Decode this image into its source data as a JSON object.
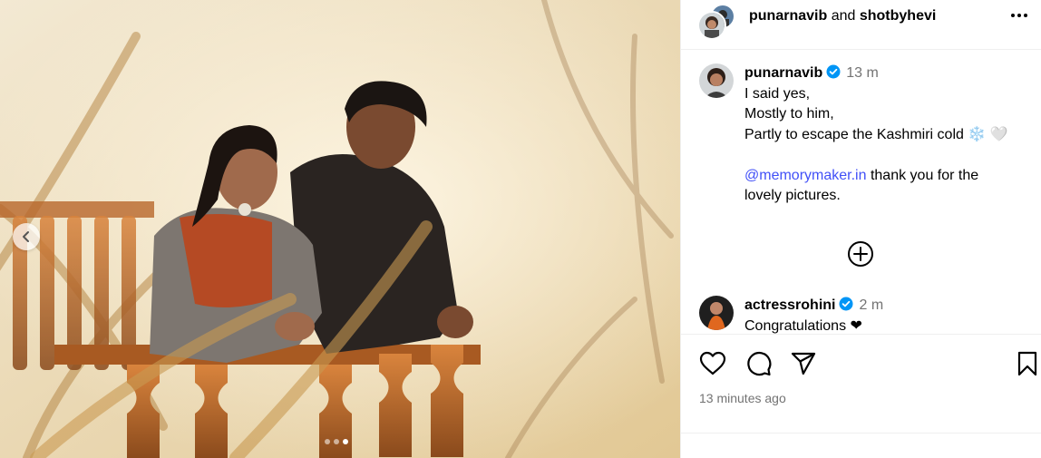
{
  "post": {
    "carousel": {
      "slide_count": 3,
      "active_index": 2
    },
    "header": {
      "user1": "punarnavib",
      "connector": "and",
      "user2": "shotbyhevi"
    },
    "caption": {
      "username": "punarnavib",
      "time": "13 m",
      "lines": [
        "I said yes,",
        "Mostly to him,",
        "Partly to escape the Kashmiri cold ❄️ 🤍"
      ],
      "mention": "@memorymaker.in",
      "mention_rest": "thank you for the",
      "last_line": "lovely pictures."
    },
    "comments": [
      {
        "username": "actressrohini",
        "time": "2 m",
        "text": "Congratulations ❤"
      }
    ],
    "timestamp": "13 minutes ago"
  },
  "icons": [
    "chevron-left-icon",
    "more-icon",
    "verified-icon",
    "plus-circle-icon",
    "heart-icon",
    "comment-icon",
    "share-icon",
    "bookmark-icon"
  ],
  "colors": {
    "mention": "#4150f7",
    "verified": "#0095f6",
    "muted": "#737373"
  }
}
